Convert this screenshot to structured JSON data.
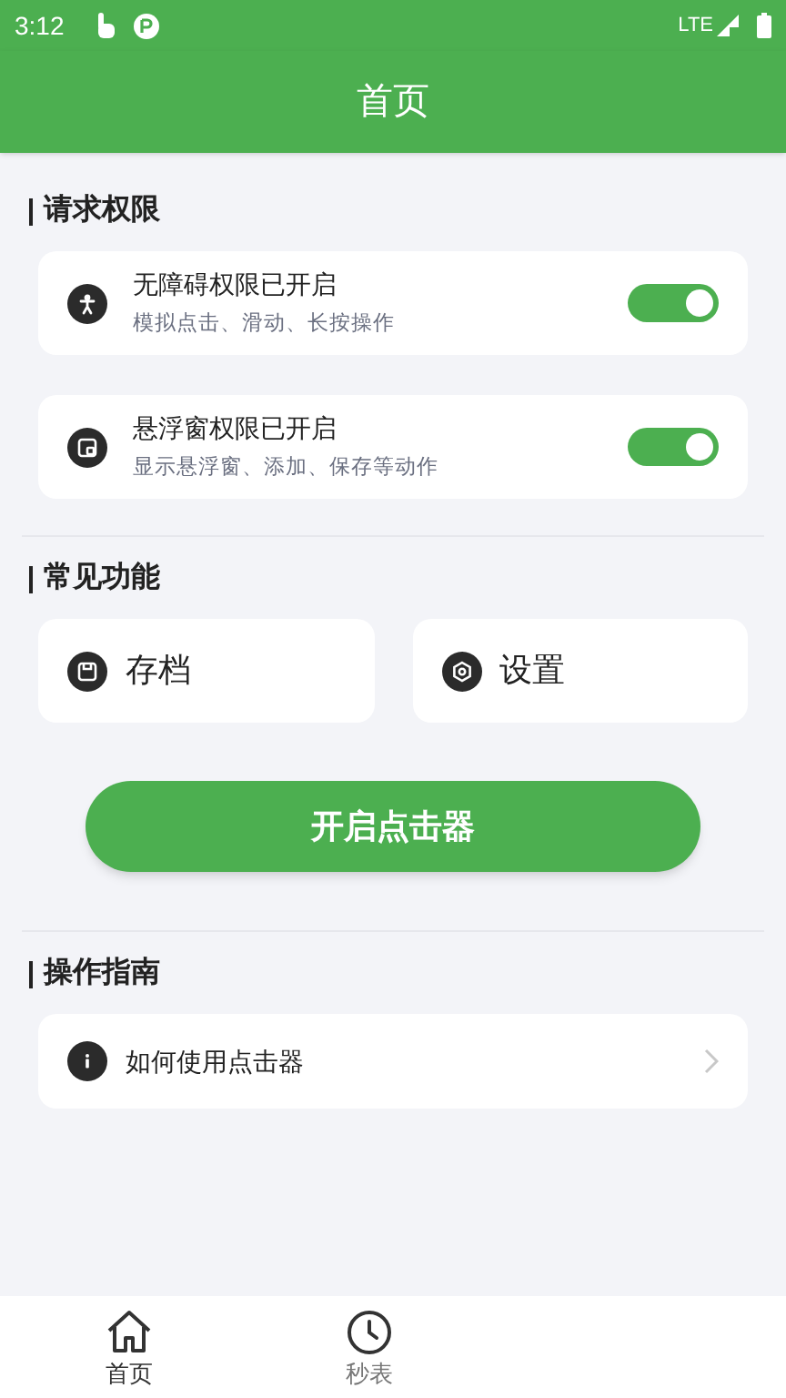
{
  "status_bar": {
    "time": "3:12",
    "network": "LTE"
  },
  "header": {
    "title": "首页"
  },
  "permissions": {
    "title": "请求权限",
    "items": [
      {
        "kind": "accessibility",
        "title": "无障碍权限已开启",
        "subtitle": "模拟点击、滑动、长按操作",
        "on": true
      },
      {
        "kind": "window",
        "title": "悬浮窗权限已开启",
        "subtitle": "显示悬浮窗、添加、保存等动作",
        "on": true
      }
    ]
  },
  "features": {
    "title": "常见功能",
    "items": [
      {
        "kind": "save",
        "label": "存档"
      },
      {
        "kind": "settings",
        "label": "设置"
      }
    ]
  },
  "start_button": "开启点击器",
  "guide": {
    "title": "操作指南",
    "items": [
      {
        "label": "如何使用点击器"
      }
    ]
  },
  "bottom_nav": [
    {
      "kind": "home",
      "label": "首页",
      "selected": true
    },
    {
      "kind": "clock",
      "label": "秒表",
      "selected": false
    }
  ]
}
